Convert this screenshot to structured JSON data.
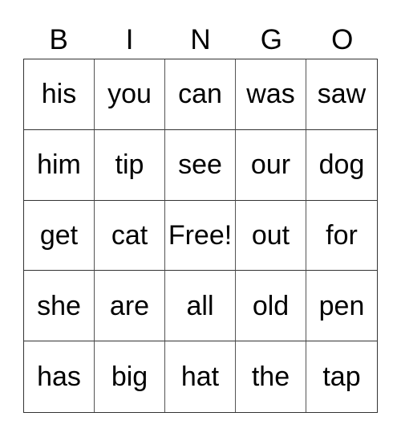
{
  "header": [
    "B",
    "I",
    "N",
    "G",
    "O"
  ],
  "rows": [
    [
      "his",
      "you",
      "can",
      "was",
      "saw"
    ],
    [
      "him",
      "tip",
      "see",
      "our",
      "dog"
    ],
    [
      "get",
      "cat",
      "Free!",
      "out",
      "for"
    ],
    [
      "she",
      "are",
      "all",
      "old",
      "pen"
    ],
    [
      "has",
      "big",
      "hat",
      "the",
      "tap"
    ]
  ]
}
